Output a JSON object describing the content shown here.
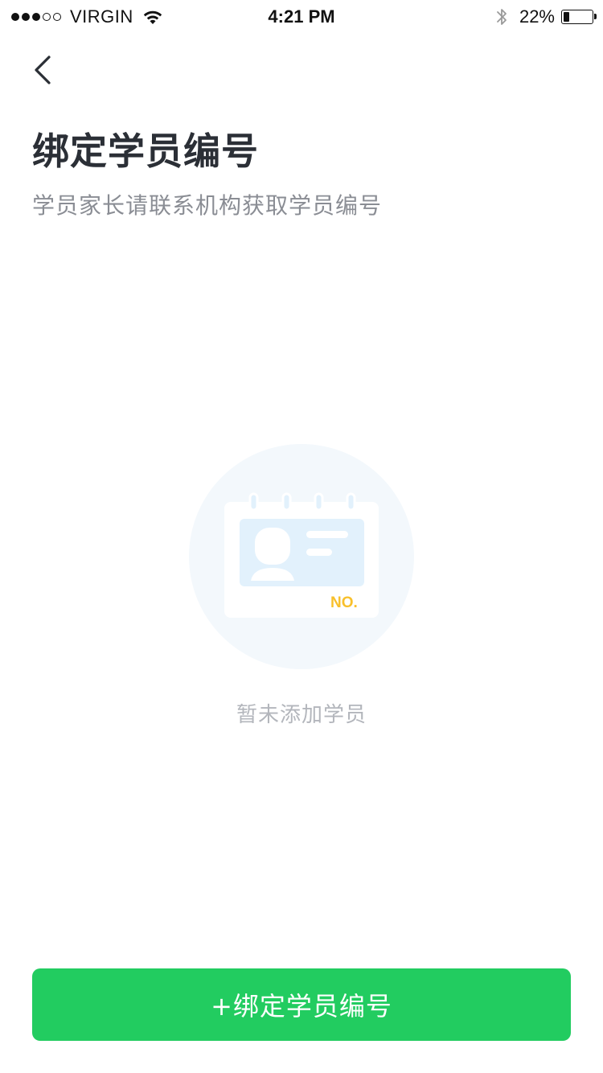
{
  "status_bar": {
    "carrier": "VIRGIN",
    "signal_bars_filled": 3,
    "signal_bars_total": 5,
    "time": "4:21 PM",
    "battery_percent_label": "22%",
    "battery_level": 0.22
  },
  "nav": {
    "back_icon": "chevron-left-icon"
  },
  "header": {
    "title": "绑定学员编号",
    "subtitle": "学员家长请联系机构获取学员编号"
  },
  "empty_state": {
    "illustration_icon": "student-id-card-icon",
    "card_label": "NO.",
    "message": "暂未添加学员"
  },
  "actions": {
    "bind_label": "+绑定学员编号"
  },
  "colors": {
    "primary": "#22cc60",
    "title": "#2b2f36",
    "subtitle": "#8a8d94",
    "empty_text": "#b3b6bc",
    "card_accent": "#f8c02c"
  }
}
